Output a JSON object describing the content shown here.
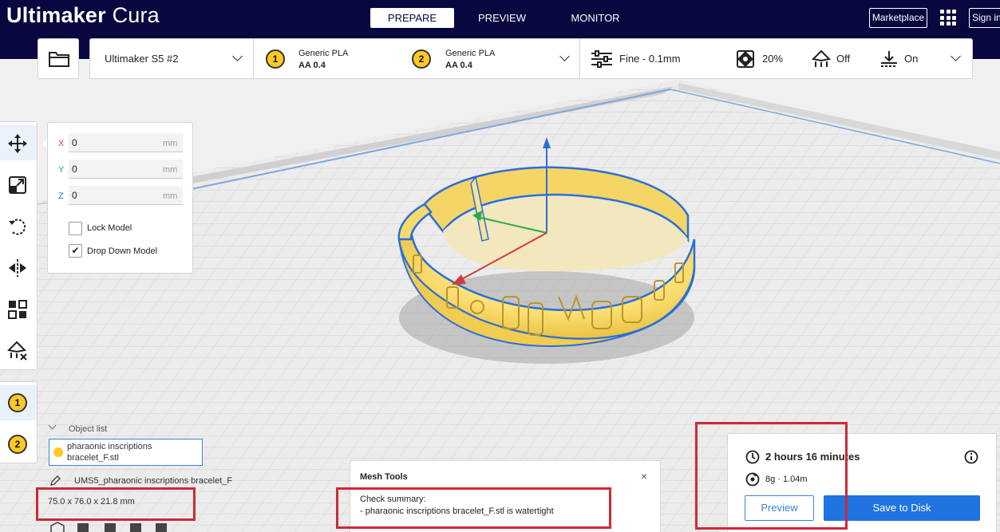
{
  "app": {
    "brand_bold": "Ultimaker",
    "brand_light": "Cura"
  },
  "stages": [
    {
      "label": "PREPARE",
      "active": true
    },
    {
      "label": "PREVIEW",
      "active": false
    },
    {
      "label": "MONITOR",
      "active": false
    }
  ],
  "topbar": {
    "marketplace_label": "Marketplace",
    "signin_label": "Sign in"
  },
  "header": {
    "printer": "Ultimaker S5 #2",
    "extruder1": {
      "number": "1",
      "material": "Generic PLA",
      "core": "AA 0.4"
    },
    "extruder2": {
      "number": "2",
      "material": "Generic PLA",
      "core": "AA 0.4"
    },
    "profile": "Fine - 0.1mm",
    "infill": "20%",
    "support": "Off",
    "adhesion": "On"
  },
  "move_panel": {
    "x": {
      "label": "X",
      "value": "0",
      "unit": "mm"
    },
    "y": {
      "label": "Y",
      "value": "0",
      "unit": "mm"
    },
    "z": {
      "label": "Z",
      "value": "0",
      "unit": "mm"
    },
    "lock_model": {
      "label": "Lock Model",
      "checked": false
    },
    "drop_down_model": {
      "label": "Drop Down Model",
      "checked": true,
      "mark": "✔"
    }
  },
  "extruder_buttons": [
    "1",
    "2"
  ],
  "object_list": {
    "header": "Object list",
    "item": "pharaonic inscriptions bracelet_F.stl",
    "job_name": "UMS5_pharaonic inscriptions bracelet_F",
    "dimensions": "75.0 x 76.0 x 21.8 mm"
  },
  "mesh_tools": {
    "title": "Mesh Tools",
    "close": "×",
    "summary_line1": "Check summary:",
    "summary_line2": "- pharaonic inscriptions bracelet_F.stl is watertight"
  },
  "print_info": {
    "time": "2 hours 16 minutes",
    "material": "8g · 1.04m",
    "preview_label": "Preview",
    "save_label": "Save to Disk"
  },
  "colors": {
    "topbar_bg": "#08073f",
    "accent_blue": "#1f74e0",
    "model_yellow": "#ffe27a",
    "highlight_red": "#cc2a36",
    "extruder_yellow": "#ffc924"
  }
}
